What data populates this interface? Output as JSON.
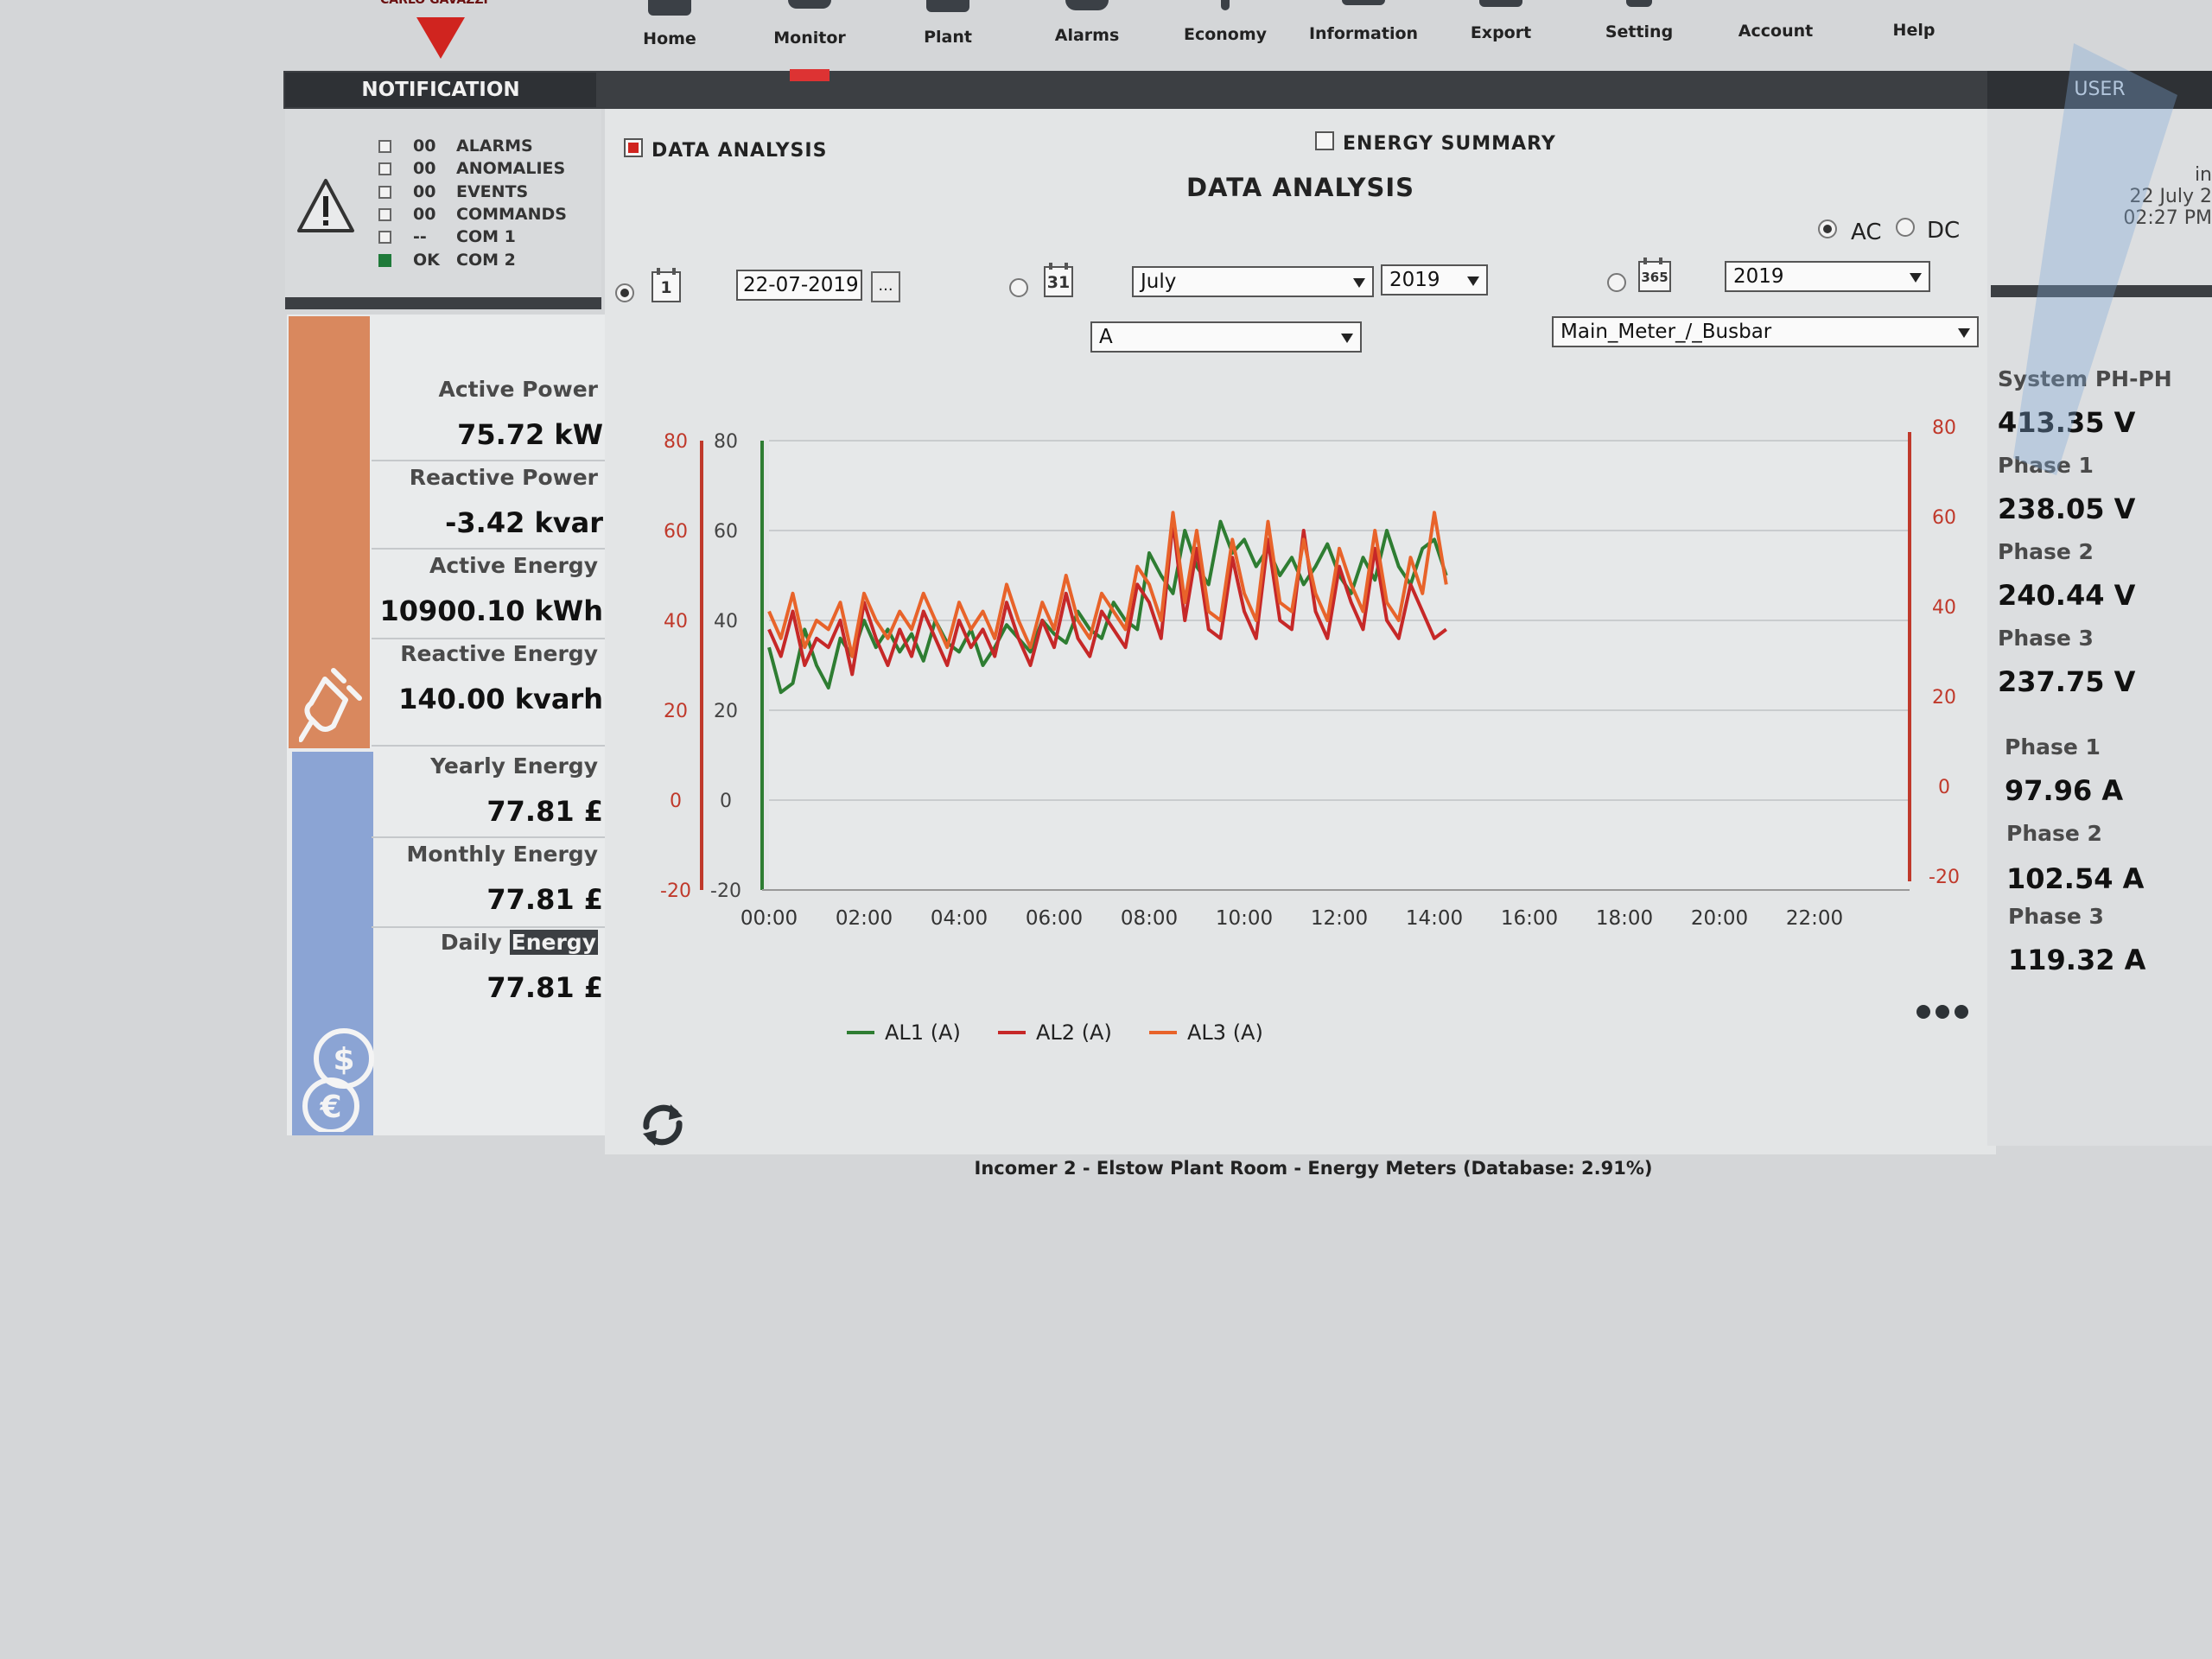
{
  "logo": {
    "text": "CARLO GAVAZZI"
  },
  "nav": [
    {
      "label": "Home",
      "icon": "home-icon"
    },
    {
      "label": "Monitor",
      "icon": "monitor-icon"
    },
    {
      "label": "Plant",
      "icon": "plant-icon"
    },
    {
      "label": "Alarms",
      "icon": "alarm-icon"
    },
    {
      "label": "Economy",
      "icon": "economy-icon"
    },
    {
      "label": "Information",
      "icon": "information-icon"
    },
    {
      "label": "Export",
      "icon": "export-icon"
    },
    {
      "label": "Setting",
      "icon": "setting-icon"
    },
    {
      "label": "Account",
      "icon": "account-icon"
    },
    {
      "label": "Help",
      "icon": "help-icon"
    }
  ],
  "notification": {
    "title": "NOTIFICATION",
    "rows": [
      {
        "count": "00",
        "label": "ALARMS",
        "ok": false
      },
      {
        "count": "00",
        "label": "ANOMALIES",
        "ok": false
      },
      {
        "count": "00",
        "label": "EVENTS",
        "ok": false
      },
      {
        "count": "00",
        "label": "COMMANDS",
        "ok": false
      },
      {
        "count": "--",
        "label": "COM 1",
        "ok": false
      },
      {
        "count": "OK",
        "label": "COM 2",
        "ok": true
      }
    ]
  },
  "power": {
    "active_power_label": "Active Power",
    "active_power_value": "75.72 kW",
    "reactive_power_label": "Reactive Power",
    "reactive_power_value": "-3.42 kvar",
    "active_energy_label": "Active Energy",
    "active_energy_value": "10900.10 kWh",
    "reactive_energy_label": "Reactive Energy",
    "reactive_energy_value": "140.00 kvarh",
    "yearly_energy_label": "Yearly Energy",
    "yearly_energy_value": "77.81 £",
    "monthly_energy_label": "Monthly Energy",
    "monthly_energy_value": "77.81 £",
    "daily_label_prefix": "Daily",
    "daily_label_highlight": "Energy",
    "daily_energy_value": "77.81 £"
  },
  "analysis": {
    "data_analysis_label": "DATA ANALYSIS",
    "energy_summary_label": "ENERGY SUMMARY",
    "section_title": "DATA ANALYSIS",
    "ac_label": "AC",
    "dc_label": "DC",
    "day_icon": "1",
    "date_value": "22-07-2019",
    "date_btn": "...",
    "month_icon": "31",
    "month_value": "July",
    "month_year_value": "2019",
    "year_icon": "365",
    "year_value": "2019",
    "quantity_value": "A",
    "meter_value": "Main_Meter_/_Busbar"
  },
  "user": {
    "title": "USER",
    "line1": "in",
    "line2": "22 July 2",
    "line3": "02:27 PM"
  },
  "readings": {
    "system_label": "System PH-PH",
    "system_value": "413.35 V",
    "v1_label": "Phase 1",
    "v1_value": "238.05 V",
    "v2_label": "Phase 2",
    "v2_value": "240.44 V",
    "v3_label": "Phase 3",
    "v3_value": "237.75 V",
    "a1_label": "Phase 1",
    "a1_value": "97.96 A",
    "a2_label": "Phase 2",
    "a2_value": "102.54 A",
    "a3_label": "Phase 3",
    "a3_value": "119.32 A"
  },
  "footer": {
    "text": "Incomer 2 - Elstow Plant Room - Energy Meters (Database: 2.91%)"
  },
  "colors": {
    "al1": "#2e7d32",
    "al2": "#c62828",
    "al3": "#e8632a",
    "axis_red": "#c0392b"
  },
  "chart_data": {
    "type": "line",
    "xlabel": "",
    "ylabel": "",
    "x_ticks": [
      "00:00",
      "02:00",
      "04:00",
      "06:00",
      "08:00",
      "10:00",
      "12:00",
      "14:00",
      "16:00",
      "18:00",
      "20:00",
      "22:00"
    ],
    "y_ticks": [
      80,
      60,
      40,
      20,
      0,
      -20
    ],
    "y_ticks_right": [
      80,
      60,
      40,
      20,
      0,
      -20
    ],
    "ylim": [
      -20,
      80
    ],
    "xlim": [
      0,
      24
    ],
    "legend": "bottom",
    "grid": true,
    "x": [
      0.0,
      0.25,
      0.5,
      0.75,
      1.0,
      1.25,
      1.5,
      1.75,
      2.0,
      2.25,
      2.5,
      2.75,
      3.0,
      3.25,
      3.5,
      3.75,
      4.0,
      4.25,
      4.5,
      4.75,
      5.0,
      5.25,
      5.5,
      5.75,
      6.0,
      6.25,
      6.5,
      6.75,
      7.0,
      7.25,
      7.5,
      7.75,
      8.0,
      8.25,
      8.5,
      8.75,
      9.0,
      9.25,
      9.5,
      9.75,
      10.0,
      10.25,
      10.5,
      10.75,
      11.0,
      11.25,
      11.5,
      11.75,
      12.0,
      12.25,
      12.5,
      12.75,
      13.0,
      13.25,
      13.5,
      13.75,
      14.0,
      14.25
    ],
    "series": [
      {
        "name": "AL1 (A)",
        "values": [
          34,
          24,
          26,
          38,
          30,
          25,
          36,
          32,
          40,
          34,
          38,
          33,
          37,
          31,
          40,
          35,
          33,
          38,
          30,
          34,
          39,
          36,
          33,
          40,
          37,
          35,
          42,
          38,
          36,
          44,
          40,
          38,
          55,
          50,
          46,
          60,
          52,
          48,
          62,
          55,
          58,
          52,
          56,
          50,
          54,
          48,
          52,
          57,
          50,
          46,
          54,
          49,
          60,
          52,
          48,
          56,
          58,
          50
        ]
      },
      {
        "name": "AL2 (A)",
        "values": [
          38,
          32,
          42,
          30,
          36,
          34,
          40,
          28,
          44,
          36,
          30,
          38,
          32,
          42,
          36,
          30,
          40,
          34,
          38,
          32,
          44,
          36,
          30,
          40,
          34,
          46,
          36,
          32,
          42,
          38,
          34,
          48,
          44,
          36,
          62,
          40,
          56,
          38,
          36,
          54,
          42,
          36,
          58,
          40,
          38,
          60,
          42,
          36,
          52,
          44,
          38,
          56,
          40,
          36,
          48,
          42,
          36,
          38
        ]
      },
      {
        "name": "AL3 (A)",
        "values": [
          42,
          36,
          46,
          34,
          40,
          38,
          44,
          32,
          46,
          40,
          36,
          42,
          38,
          46,
          40,
          34,
          44,
          38,
          42,
          36,
          48,
          40,
          34,
          44,
          38,
          50,
          40,
          36,
          46,
          42,
          38,
          52,
          48,
          40,
          64,
          44,
          60,
          42,
          40,
          58,
          46,
          40,
          62,
          44,
          42,
          58,
          46,
          40,
          56,
          48,
          42,
          60,
          44,
          40,
          54,
          46,
          64,
          48
        ]
      }
    ]
  }
}
